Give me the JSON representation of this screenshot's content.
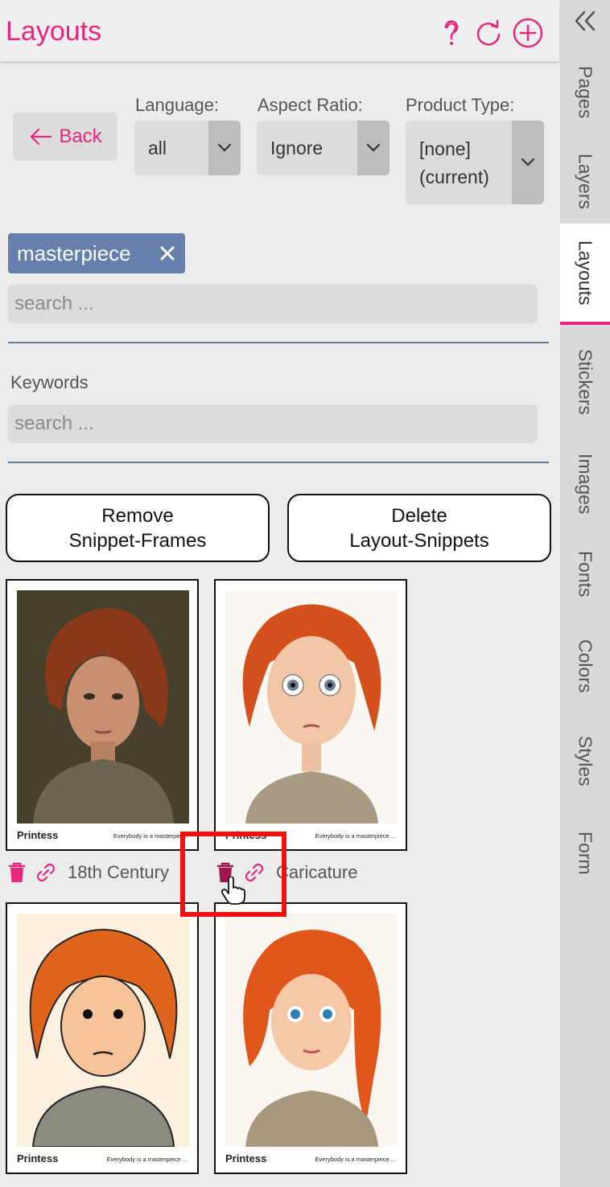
{
  "header": {
    "title": "Layouts"
  },
  "header_icons": [
    "help-icon",
    "refresh-icon",
    "add-icon"
  ],
  "sidebar": {
    "collapse_icon": "double-chevron-left-icon",
    "tabs": [
      {
        "label": "Pages"
      },
      {
        "label": "Layers"
      },
      {
        "label": "Layouts",
        "active": true
      },
      {
        "label": "Stickers"
      },
      {
        "label": "Images"
      },
      {
        "label": "Fonts"
      },
      {
        "label": "Colors"
      },
      {
        "label": "Styles"
      },
      {
        "label": "Form"
      }
    ]
  },
  "filters": {
    "back_label": "Back",
    "language": {
      "label": "Language:",
      "value": "all"
    },
    "aspect_ratio": {
      "label": "Aspect Ratio:",
      "value": "Ignore"
    },
    "product_type": {
      "label": "Product Type:",
      "value_line1": "[none]",
      "value_line2": "(current)"
    }
  },
  "tag": {
    "label": "masterpiece"
  },
  "search": {
    "placeholder": "search ..."
  },
  "keywords": {
    "label": "Keywords",
    "placeholder": "search ..."
  },
  "actions": {
    "remove_label": "Remove\nSnippet-Frames",
    "delete_label": "Delete\nLayout-Snippets"
  },
  "cards": [
    {
      "name": "18th Century",
      "brand": "Printess",
      "tagline": "Everybody is a masterpiece"
    },
    {
      "name": "Caricature",
      "brand": "Printess",
      "tagline": "Everybody is a masterpiece ..."
    },
    {
      "name": "",
      "brand": "Printess",
      "tagline": "Everybody is a masterpiece ..."
    },
    {
      "name": "",
      "brand": "Printess",
      "tagline": "Everybody is a masterpiece ..."
    }
  ],
  "colors": {
    "accent": "#e6267f",
    "tag_bg": "#667fad",
    "highlight": "#ee1111"
  }
}
